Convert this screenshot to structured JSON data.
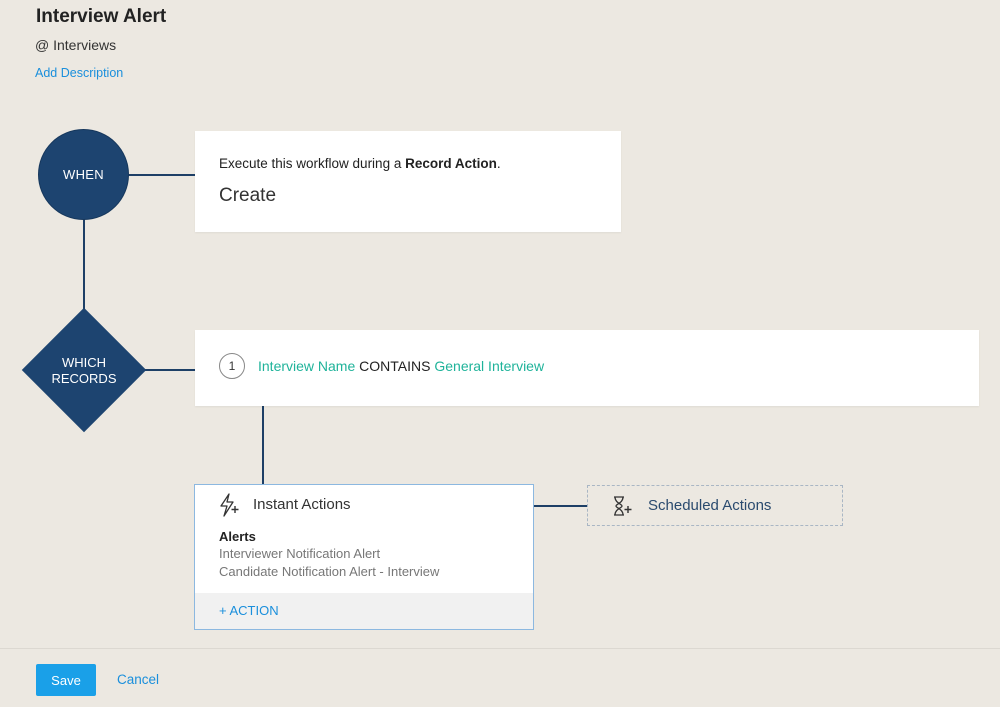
{
  "header": {
    "title": "Interview Alert",
    "module": "@ Interviews",
    "add_description": "Add Description"
  },
  "when": {
    "node_label": "WHEN",
    "text_prefix": "Execute this workflow during a ",
    "text_bold": "Record Action",
    "text_suffix": ".",
    "action": "Create"
  },
  "which": {
    "node_line1": "WHICH",
    "node_line2": "RECORDS",
    "criteria": [
      {
        "number": "1",
        "field": "Interview Name",
        "operator": "CONTAINS",
        "value": "General Interview"
      }
    ]
  },
  "instant_actions": {
    "title": "Instant Actions",
    "icon": "lightning-plus-icon",
    "alerts_heading": "Alerts",
    "alerts": [
      "Interviewer Notification Alert",
      "Candidate Notification Alert - Interview"
    ],
    "add_action": "+ ACTION"
  },
  "scheduled_actions": {
    "title": "Scheduled Actions",
    "icon": "hourglass-plus-icon"
  },
  "footer": {
    "save": "Save",
    "cancel": "Cancel"
  },
  "colors": {
    "node_blue": "#1d4470",
    "link_blue": "#1a8fdc",
    "teal": "#1fb39a",
    "save_button": "#1aa0e8",
    "background": "#ece8e1"
  }
}
